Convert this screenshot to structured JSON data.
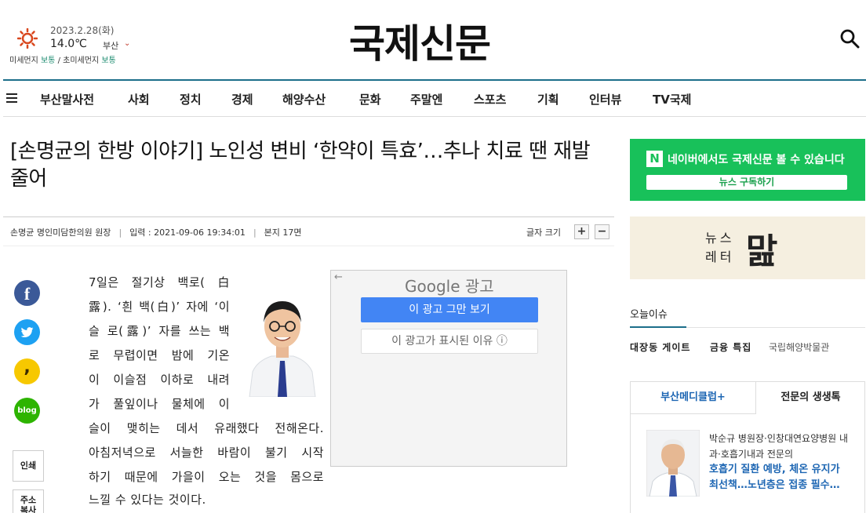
{
  "weather": {
    "date": "2023.2.28(화)",
    "temp": "14.0℃",
    "city": "부산",
    "dust_label": "미세먼지 ",
    "dust_value": "보통",
    "sep": " / ",
    "ultra_label": "초미세먼지 ",
    "ultra_value": "보통",
    "icon": "sun-icon"
  },
  "header": {
    "logo": "국제신문",
    "search_icon": "search-icon"
  },
  "nav": {
    "items": [
      "부산말사전",
      "사회",
      "정치",
      "경제",
      "해양수산",
      "문화",
      "주말엔",
      "스포츠",
      "기획",
      "인터뷰",
      "TV국제"
    ]
  },
  "article": {
    "title": "[손명균의 한방 이야기] 노인성 변비 ‘한약이 특효’…추나 치료 땐 재발 줄어",
    "author": "손명균 명인미담한의원 원장",
    "published": "입력 : 2021-09-06 19:34:01",
    "page": "본지 17면",
    "font_size_label": "글자 크기",
    "font_plus": "+",
    "font_minus": "−",
    "body_lines": [
      "7일은 절기상 백로( 白",
      "露). ‘흰 백(白)’ 자에 ‘이",
      "슬 로(露)’ 자를 쓰는 백",
      "로 무렵이면 밤에 기온",
      "이 이슬점 이하로 내려",
      "가 풀잎이나 물체에 이",
      "슬이 맺히는 데서 유래했다 전해온다.",
      "아침저녁으로 서늘한 바람이 불기 시작",
      "하기 때문에 가을이 오는 것을 몸으로",
      "느낄 수 있다는 것이다."
    ]
  },
  "share": {
    "facebook": "f",
    "kakao": ",",
    "blog": "blog",
    "print": "인쇄",
    "copy": "주소\n복사"
  },
  "ad": {
    "back": "←",
    "google": "Google",
    "google_suffix": " 광고",
    "stop": "이 광고 그만 보기",
    "why": "이 광고가 표시된 이유 ⓘ"
  },
  "sidebar": {
    "naver_icon": "N",
    "naver_text": "네이버에서도 국제신문 볼 수 있습니다",
    "naver_button": "뉴스 구독하기",
    "letter_text": "뉴스\n레터",
    "letter_logo": "맖",
    "issue_heading": "오늘이슈",
    "issue_tags": [
      "대장동 게이트",
      "금융 특집",
      "국립해양박물관"
    ],
    "tabs": [
      "부산메디클럽+",
      "전문의 생생톡"
    ],
    "doctor_text": "박순규 병원장·인창대연요양병원 내과·호흡기내과 전문의",
    "doctor_headline": "호흡기 질환 예방, 체온 유지가 최선책…노년층은 접종 필수…"
  },
  "colors": {
    "accent": "#1c6e8a",
    "naver": "#18c15a",
    "link_blue": "#1d66b3",
    "facebook": "#3b5998",
    "twitter": "#1da1f2",
    "kakao": "#f7c800",
    "blog": "#2db400"
  }
}
